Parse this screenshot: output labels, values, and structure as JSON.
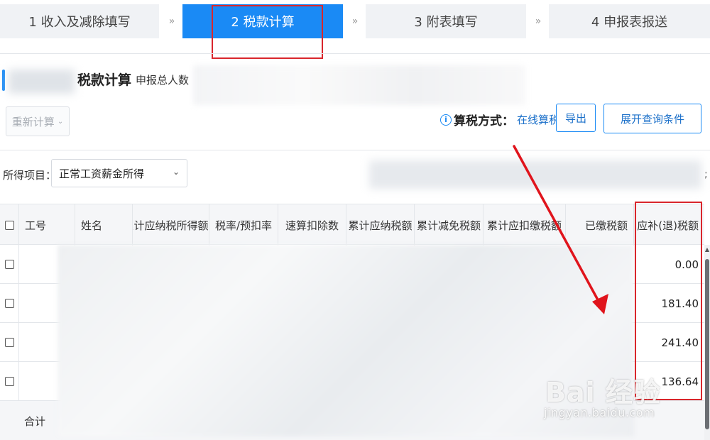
{
  "steps": [
    {
      "label": "1 收入及减除填写"
    },
    {
      "label": "2 税款计算"
    },
    {
      "label": "3 附表填写"
    },
    {
      "label": "4 申报表报送"
    }
  ],
  "step_separator": "»",
  "header": {
    "title": "税款计算",
    "sub_label": "申报总人数"
  },
  "toolbar": {
    "recalc_label": "重新计算",
    "calc_mode_label": "算税方式：",
    "calc_mode_value": "在线算税",
    "export_label": "导出",
    "expand_label": "展开查询条件"
  },
  "filter": {
    "label": "所得项目：",
    "selected": "正常工资薪金所得",
    "trailing": ";"
  },
  "table": {
    "columns": [
      {
        "key": "emp_no",
        "label": "工号"
      },
      {
        "key": "name",
        "label": "姓名"
      },
      {
        "key": "cum_taxable_income",
        "label": "累计应纳税所得额"
      },
      {
        "key": "rate",
        "label": "税率/预扣率"
      },
      {
        "key": "quick_deduction",
        "label": "速算扣除数"
      },
      {
        "key": "cum_tax_payable",
        "label": "累计应纳税额"
      },
      {
        "key": "cum_tax_relief",
        "label": "累计减免税额"
      },
      {
        "key": "cum_tax_withheld",
        "label": "累计应扣缴税额"
      },
      {
        "key": "tax_paid",
        "label": "已缴税额"
      },
      {
        "key": "tax_due_refund",
        "label": "应补(退)税额"
      }
    ],
    "rows": [
      {
        "tax_due_refund": "0.00"
      },
      {
        "tax_due_refund": "181.40"
      },
      {
        "tax_due_refund": "241.40"
      },
      {
        "tax_due_refund": "136.64"
      }
    ],
    "total_label": "合计"
  },
  "watermark": {
    "main": "Bai 经验",
    "sub": "jingyan.baidu.com"
  },
  "colors": {
    "accent": "#1a8af5",
    "highlight": "#d9262c"
  },
  "icons": [
    "info-icon",
    "chevron-down-icon",
    "red-arrow-annotation"
  ]
}
